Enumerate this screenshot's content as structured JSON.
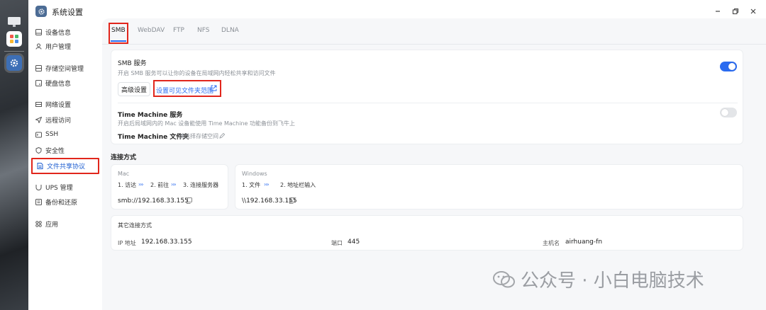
{
  "window": {
    "title": "系统设置"
  },
  "sidebar": {
    "items": [
      {
        "label": "设备信息",
        "icon": "device-icon"
      },
      {
        "label": "用户管理",
        "icon": "user-icon"
      },
      {
        "label": "存储空间管理",
        "icon": "storage-icon"
      },
      {
        "label": "硬盘信息",
        "icon": "disk-icon"
      },
      {
        "label": "网络设置",
        "icon": "network-icon"
      },
      {
        "label": "远程访问",
        "icon": "remote-icon"
      },
      {
        "label": "SSH",
        "icon": "ssh-icon"
      },
      {
        "label": "安全性",
        "icon": "shield-icon"
      },
      {
        "label": "文件共享协议",
        "icon": "file-share-icon",
        "active": true
      },
      {
        "label": "UPS 管理",
        "icon": "ups-icon"
      },
      {
        "label": "备份和还原",
        "icon": "backup-icon"
      },
      {
        "label": "应用",
        "icon": "apps-icon"
      }
    ]
  },
  "tabs": [
    "SMB",
    "WebDAV",
    "FTP",
    "NFS",
    "DLNA"
  ],
  "smb": {
    "title": "SMB 服务",
    "desc": "开启 SMB 服务可以让你的设备在局域网内轻松共享和访问文件",
    "enabled": true,
    "advanced_label": "高级设置",
    "visible_folders_label": "设置可见文件夹范围"
  },
  "time_machine": {
    "title": "Time Machine 服务",
    "desc": "开启后局域网内的 Mac 设备能使用 Time Machine 功能备份到飞牛上",
    "enabled": false,
    "folder_label": "Time Machine 文件夹",
    "folder_placeholder": "请选择存储空间"
  },
  "connection": {
    "title": "连接方式",
    "mac": {
      "os": "Mac",
      "steps": [
        "1. 访达",
        "2. 前往",
        "3. 连接服务器"
      ],
      "address": "smb://192.168.33.155"
    },
    "windows": {
      "os": "Windows",
      "steps": [
        "1. 文件",
        "2. 地址栏输入"
      ],
      "address": "\\\\192.168.33.155"
    }
  },
  "other": {
    "title": "其它连接方式",
    "ip_label": "IP 地址",
    "ip_value": "192.168.33.155",
    "port_label": "端口",
    "port_value": "445",
    "host_label": "主机名",
    "host_value": "airhuang-fn"
  },
  "watermark": {
    "text": "公众号 · 小白电脑技术"
  },
  "colors": {
    "accent": "#2a6bf0",
    "highlight": "#e1261c"
  }
}
